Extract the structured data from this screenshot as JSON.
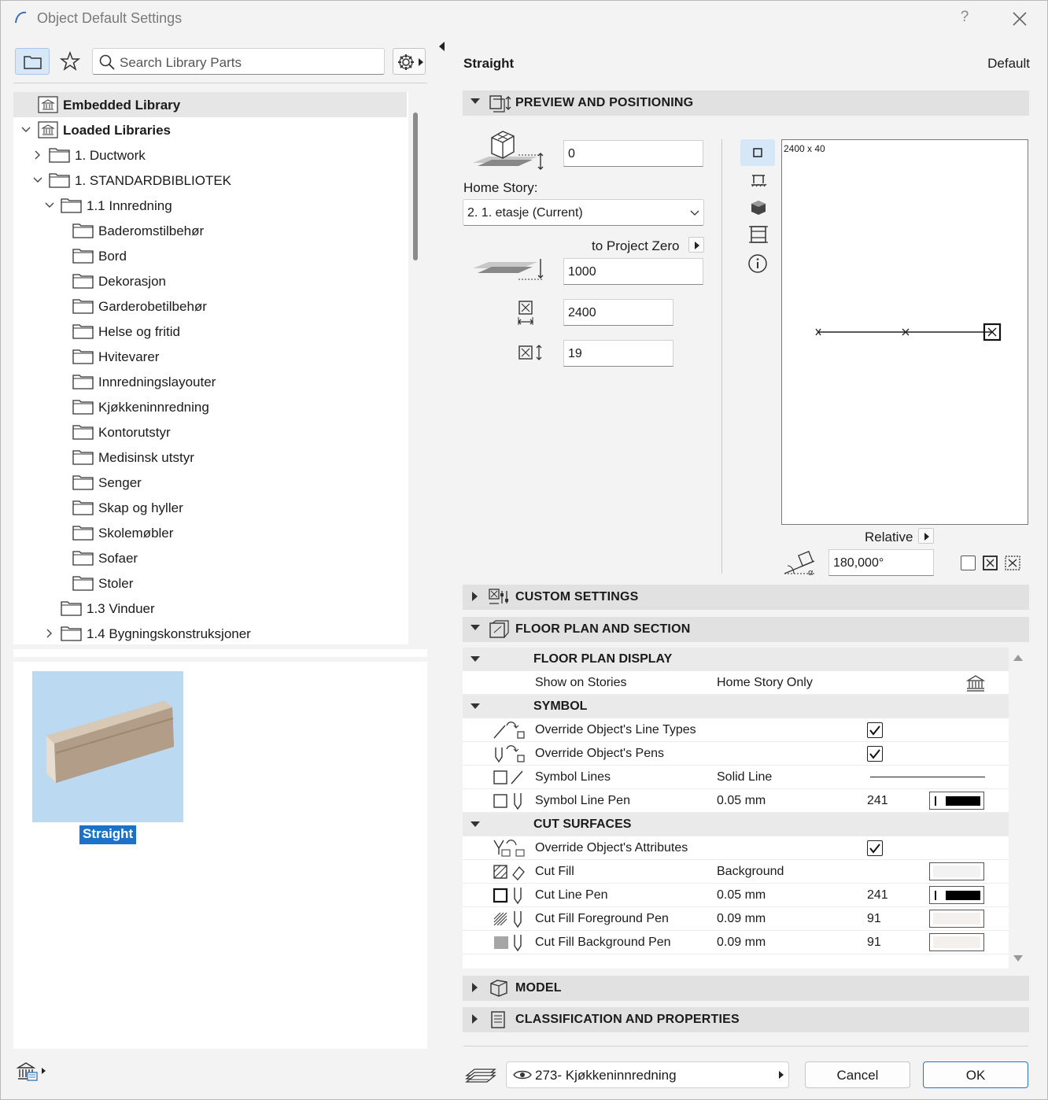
{
  "window": {
    "title": "Object Default Settings",
    "help": "?"
  },
  "search": {
    "placeholder": "Search Library Parts"
  },
  "tree": [
    {
      "label": "Embedded Library",
      "bold": true,
      "indent": 0,
      "icon": "library-icon",
      "chevron": "",
      "selected": true
    },
    {
      "label": "Loaded Libraries",
      "bold": true,
      "indent": 0,
      "icon": "library-icon",
      "chevron": "down"
    },
    {
      "label": "1. Ductwork",
      "indent": 1,
      "icon": "folder-icon",
      "chevron": "right"
    },
    {
      "label": "1. STANDARDBIBLIOTEK",
      "indent": 1,
      "icon": "folder-icon",
      "chevron": "down"
    },
    {
      "label": "1.1 Innredning",
      "indent": 2,
      "icon": "folder-icon",
      "chevron": "down"
    },
    {
      "label": "Baderomstilbehør",
      "indent": 3,
      "icon": "folder-icon",
      "chevron": ""
    },
    {
      "label": "Bord",
      "indent": 3,
      "icon": "folder-icon",
      "chevron": ""
    },
    {
      "label": "Dekorasjon",
      "indent": 3,
      "icon": "folder-icon",
      "chevron": ""
    },
    {
      "label": "Garderobetilbehør",
      "indent": 3,
      "icon": "folder-icon",
      "chevron": ""
    },
    {
      "label": "Helse og fritid",
      "indent": 3,
      "icon": "folder-icon",
      "chevron": ""
    },
    {
      "label": "Hvitevarer",
      "indent": 3,
      "icon": "folder-icon",
      "chevron": ""
    },
    {
      "label": "Innredningslayouter",
      "indent": 3,
      "icon": "folder-icon",
      "chevron": ""
    },
    {
      "label": "Kjøkkeninnredning",
      "indent": 3,
      "icon": "folder-icon",
      "chevron": ""
    },
    {
      "label": "Kontorutstyr",
      "indent": 3,
      "icon": "folder-icon",
      "chevron": ""
    },
    {
      "label": "Medisinsk utstyr",
      "indent": 3,
      "icon": "folder-icon",
      "chevron": ""
    },
    {
      "label": "Senger",
      "indent": 3,
      "icon": "folder-icon",
      "chevron": ""
    },
    {
      "label": "Skap og hyller",
      "indent": 3,
      "icon": "folder-icon",
      "chevron": ""
    },
    {
      "label": "Skolemøbler",
      "indent": 3,
      "icon": "folder-icon",
      "chevron": ""
    },
    {
      "label": "Sofaer",
      "indent": 3,
      "icon": "folder-icon",
      "chevron": ""
    },
    {
      "label": "Stoler",
      "indent": 3,
      "icon": "folder-icon",
      "chevron": ""
    },
    {
      "label": "1.3 Vinduer",
      "indent": 2,
      "icon": "folder-icon",
      "chevron": ""
    },
    {
      "label": "1.4 Bygningskonstruksjoner",
      "indent": 2,
      "icon": "folder-icon",
      "chevron": "right"
    }
  ],
  "preview_item": {
    "label": "Straight"
  },
  "object": {
    "name": "Straight",
    "status": "Default"
  },
  "sections": {
    "preview": "PREVIEW AND POSITIONING",
    "custom": "CUSTOM SETTINGS",
    "floorplan": "FLOOR PLAN AND SECTION",
    "model": "MODEL",
    "classification": "CLASSIFICATION AND PROPERTIES"
  },
  "positioning": {
    "offset_value": "0",
    "home_story_label": "Home Story:",
    "home_story_value": "2. 1. etasje (Current)",
    "to_project_zero_label": "to Project Zero",
    "elevation_value": "1000",
    "width_value": "2400",
    "height_value": "19",
    "preview_dims": "2400 x 40",
    "relative_label": "Relative",
    "angle_value": "180,000°"
  },
  "property_rows": [
    {
      "type": "group",
      "label": "FLOOR PLAN DISPLAY"
    },
    {
      "type": "row",
      "label": "Show on Stories",
      "value": "Home Story Only",
      "icon": "",
      "extra": "stories-icon"
    },
    {
      "type": "group",
      "label": "SYMBOL"
    },
    {
      "type": "row",
      "label": "Override Object's Line Types",
      "icon": "line-type-override-icon",
      "checkbox": true
    },
    {
      "type": "row",
      "label": "Override Object's Pens",
      "icon": "pen-override-icon",
      "checkbox": true
    },
    {
      "type": "row",
      "label": "Symbol Lines",
      "value": "Solid Line",
      "icon": "symbol-lines-icon",
      "line_sample": true
    },
    {
      "type": "row",
      "label": "Symbol Line Pen",
      "value": "0.05 mm",
      "num": "241",
      "icon": "symbol-pen-icon",
      "swatch": "#000000"
    },
    {
      "type": "group",
      "label": "CUT SURFACES"
    },
    {
      "type": "row",
      "label": "Override Object's Attributes",
      "icon": "attributes-override-icon",
      "checkbox": true
    },
    {
      "type": "row",
      "label": "Cut Fill",
      "value": "Background",
      "icon": "cut-fill-icon",
      "swatch": "#f2f2f2"
    },
    {
      "type": "row",
      "label": "Cut Line Pen",
      "value": "0.05 mm",
      "num": "241",
      "icon": "cut-line-pen-icon",
      "swatch": "#000000"
    },
    {
      "type": "row",
      "label": "Cut Fill Foreground Pen",
      "value": "0.09 mm",
      "num": "91",
      "icon": "fill-foreground-pen-icon",
      "swatch": "#f3f0ee"
    },
    {
      "type": "row",
      "label": "Cut Fill Background Pen",
      "value": "0.09 mm",
      "num": "91",
      "icon": "fill-background-pen-icon",
      "swatch": "#f3f0ee"
    }
  ],
  "footer": {
    "layer": "273- Kjøkkeninnredning",
    "cancel": "Cancel",
    "ok": "OK"
  },
  "colors": {
    "accent": "#1a73c9",
    "section_bg": "#e1e1e1",
    "preview_bg": "#bcd9f2"
  }
}
